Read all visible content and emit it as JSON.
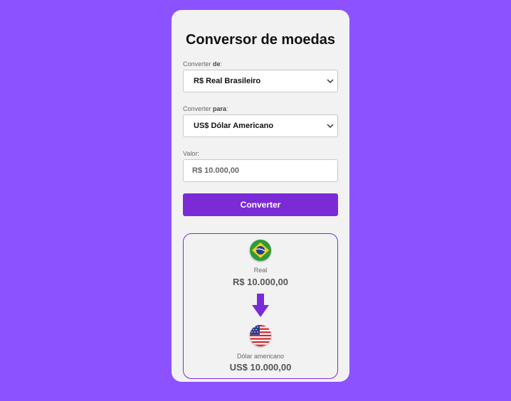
{
  "title": "Conversor de moedas",
  "from": {
    "label_prefix": "Converter ",
    "label_bold": "de",
    "label_suffix": ":",
    "selected": "R$ Real Brasileiro"
  },
  "to": {
    "label_prefix": "Converter ",
    "label_bold": "para",
    "label_suffix": ":",
    "selected": "US$ Dólar Americano"
  },
  "amount": {
    "label": "Valor:",
    "value": "R$ 10.000,00"
  },
  "convert_button": "Converter",
  "result": {
    "source": {
      "flag_icon": "brazil-flag-icon",
      "name": "Real",
      "value": "R$ 10.000,00"
    },
    "target": {
      "flag_icon": "usa-flag-icon",
      "name": "Dólar americano",
      "value": "US$ 10.000,00"
    }
  },
  "colors": {
    "background": "#8c52ff",
    "accent": "#7a2bd6",
    "card": "#f2f2f2"
  }
}
